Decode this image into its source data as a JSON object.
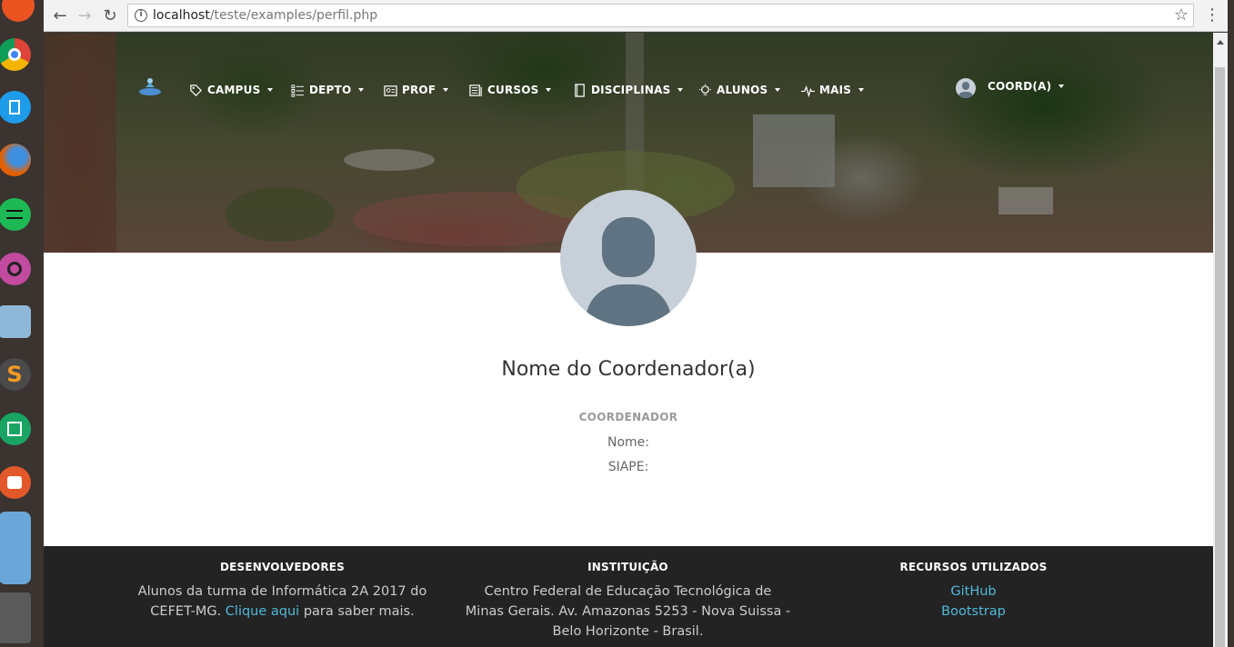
{
  "browser": {
    "url_host": "localhost",
    "url_path": "/teste/examples/perfil.php"
  },
  "navbar": {
    "items": [
      {
        "label": "CAMPUS",
        "icon": "tag-icon"
      },
      {
        "label": "DEPTO",
        "icon": "list-icon"
      },
      {
        "label": "PROF",
        "icon": "id-card-icon"
      },
      {
        "label": "CURSOS",
        "icon": "book-open-icon"
      },
      {
        "label": "DISCIPLINAS",
        "icon": "book-icon"
      },
      {
        "label": "ALUNOS",
        "icon": "lightbulb-icon"
      },
      {
        "label": "MAIS",
        "icon": "pulse-icon"
      }
    ],
    "user": {
      "label": "COORD(A)"
    }
  },
  "profile": {
    "name": "Nome do Coordenador(a)",
    "role": "COORDENADOR",
    "fields": {
      "nome_label": "Nome:",
      "siape_label": "SIAPE:"
    }
  },
  "footer": {
    "dev": {
      "title": "DESENVOLVEDORES",
      "line1": "Alunos da turma de Informática 2A 2017 do",
      "line2_pre": "CEFET-MG.",
      "link": "Clique aqui",
      "line2_post": "para saber mais."
    },
    "inst": {
      "title": "INSTITUIÇÃO",
      "line1": "Centro Federal de Educação Tecnológica de",
      "line2": "Minas Gerais. Av. Amazonas 5253 - Nova Suissa -",
      "line3": "Belo Horizonte - Brasil."
    },
    "res": {
      "title": "RECURSOS UTILIZADOS",
      "link1": "GitHub",
      "link2": "Bootstrap"
    }
  },
  "colors": {
    "link": "#4fb9d9",
    "footer_bg": "#232323",
    "avatar_bg": "#c7d0d8",
    "avatar_fg": "#5f7382"
  }
}
